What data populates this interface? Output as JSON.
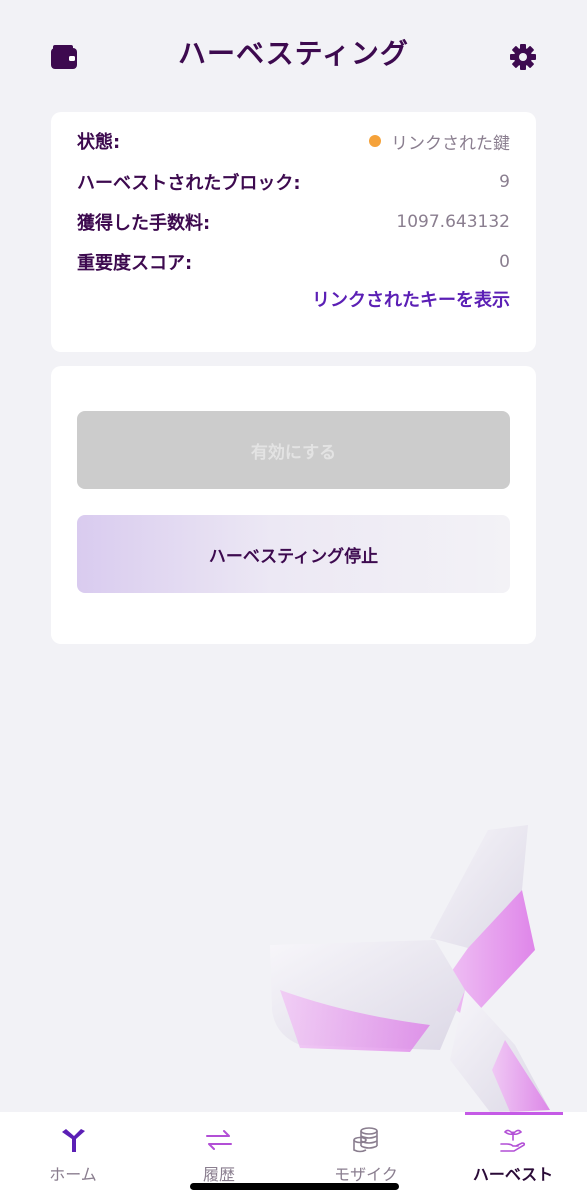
{
  "header": {
    "title": "ハーベスティング",
    "left_icon": "wallet-icon",
    "right_icon": "gear-icon"
  },
  "status_card": {
    "rows": [
      {
        "label": "状態:",
        "value": "リンクされた鍵",
        "dot_color": "#f5a23a"
      },
      {
        "label": "ハーベストされたブロック:",
        "value": "9"
      },
      {
        "label": "獲得した手数料:",
        "value": "1097.643132"
      },
      {
        "label": "重要度スコア:",
        "value": "0"
      }
    ],
    "link_label": "リンクされたキーを表示"
  },
  "actions_card": {
    "activate_label": "有効にする",
    "stop_label": "ハーベスティング停止"
  },
  "tabbar": {
    "tabs": [
      {
        "label": "ホーム",
        "icon": "symbol-logo-icon"
      },
      {
        "label": "履歴",
        "icon": "transfer-arrows-icon"
      },
      {
        "label": "モザイク",
        "icon": "coins-stack-icon"
      },
      {
        "label": "ハーベスト",
        "icon": "hand-sprout-icon",
        "active": true
      }
    ]
  },
  "colors": {
    "primary": "#3d0a4f",
    "link": "#5b1fb5",
    "status_dot": "#f5a23a",
    "active_tab_bar": "#c55ae6",
    "background": "#f2f2f6"
  }
}
